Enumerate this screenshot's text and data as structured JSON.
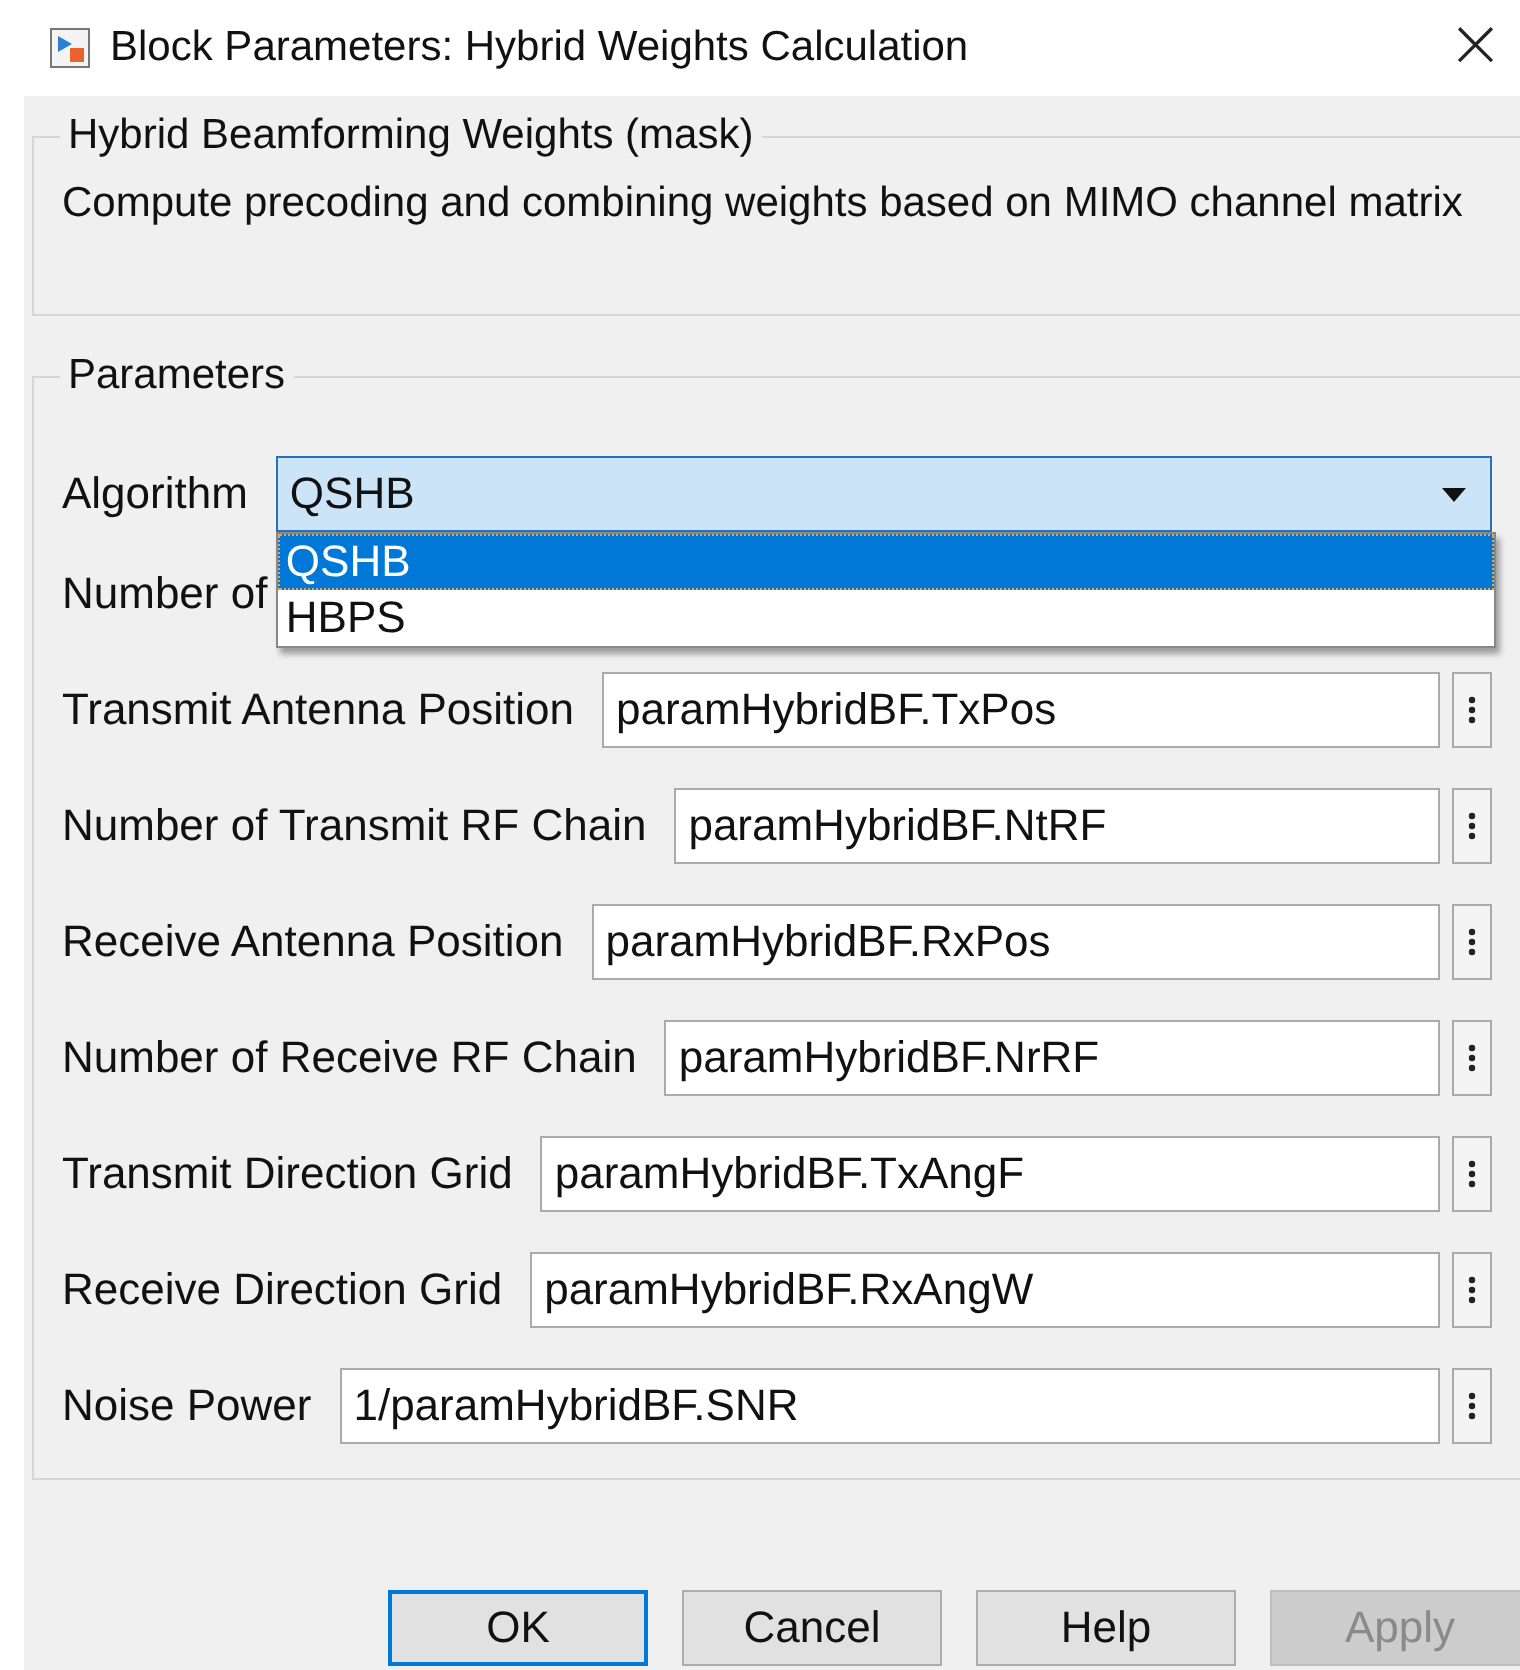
{
  "window": {
    "title": "Block Parameters: Hybrid Weights Calculation",
    "close": "×"
  },
  "description_group": {
    "title": "Hybrid Beamforming Weights (mask)",
    "text": "Compute precoding and combining weights based on MIMO channel matrix"
  },
  "parameters": {
    "title": "Parameters",
    "algorithm": {
      "label": "Algorithm",
      "value": "QSHB",
      "expanded": true,
      "options": [
        {
          "label": "QSHB",
          "selected": true
        },
        {
          "label": "HBPS",
          "selected": false
        }
      ]
    },
    "rows": [
      {
        "label": "Number of"
      },
      {
        "label": "Transmit Antenna Position",
        "value": "paramHybridBF.TxPos"
      },
      {
        "label": "Number of Transmit RF Chain",
        "value": "paramHybridBF.NtRF"
      },
      {
        "label": "Receive Antenna Position",
        "value": "paramHybridBF.RxPos"
      },
      {
        "label": "Number of Receive RF Chain",
        "value": "paramHybridBF.NrRF"
      },
      {
        "label": "Transmit Direction Grid",
        "value": "paramHybridBF.TxAngF"
      },
      {
        "label": "Receive Direction Grid",
        "value": "paramHybridBF.RxAngW"
      },
      {
        "label": "Noise Power",
        "value": "1/paramHybridBF.SNR"
      }
    ]
  },
  "buttons": [
    {
      "label": "OK",
      "default": true,
      "disabled": false
    },
    {
      "label": "Cancel",
      "default": false,
      "disabled": false
    },
    {
      "label": "Help",
      "default": false,
      "disabled": false
    },
    {
      "label": "Apply",
      "default": false,
      "disabled": true
    }
  ]
}
